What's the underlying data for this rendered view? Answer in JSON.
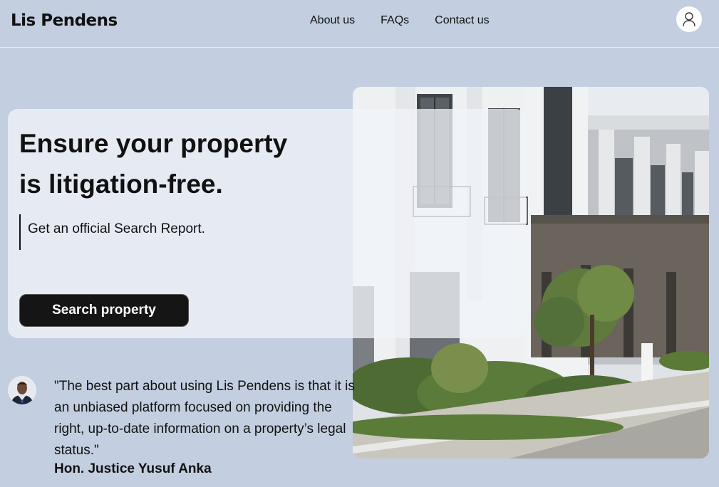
{
  "header": {
    "logo": "Lis Pendens",
    "nav": [
      {
        "label": "About us"
      },
      {
        "label": "FAQs"
      },
      {
        "label": "Contact us"
      }
    ],
    "account_icon": "user-icon"
  },
  "hero": {
    "title_line1": "Ensure your property",
    "title_line2": "is litigation-free.",
    "subtitle": "Get an official Search Report.",
    "cta_label": "Search property",
    "image_subject": "modern townhouse building"
  },
  "testimonial": {
    "quote": "\"The best part about using Lis Pendens is that it is an unbiased platform focused on providing the right, up-to-date information on a property’s legal status.\"",
    "author": "Hon. Justice Yusuf Anka"
  },
  "colors": {
    "background": "#c3cfe0",
    "card": "#f0f3f8",
    "button": "#151515",
    "text": "#111111"
  }
}
